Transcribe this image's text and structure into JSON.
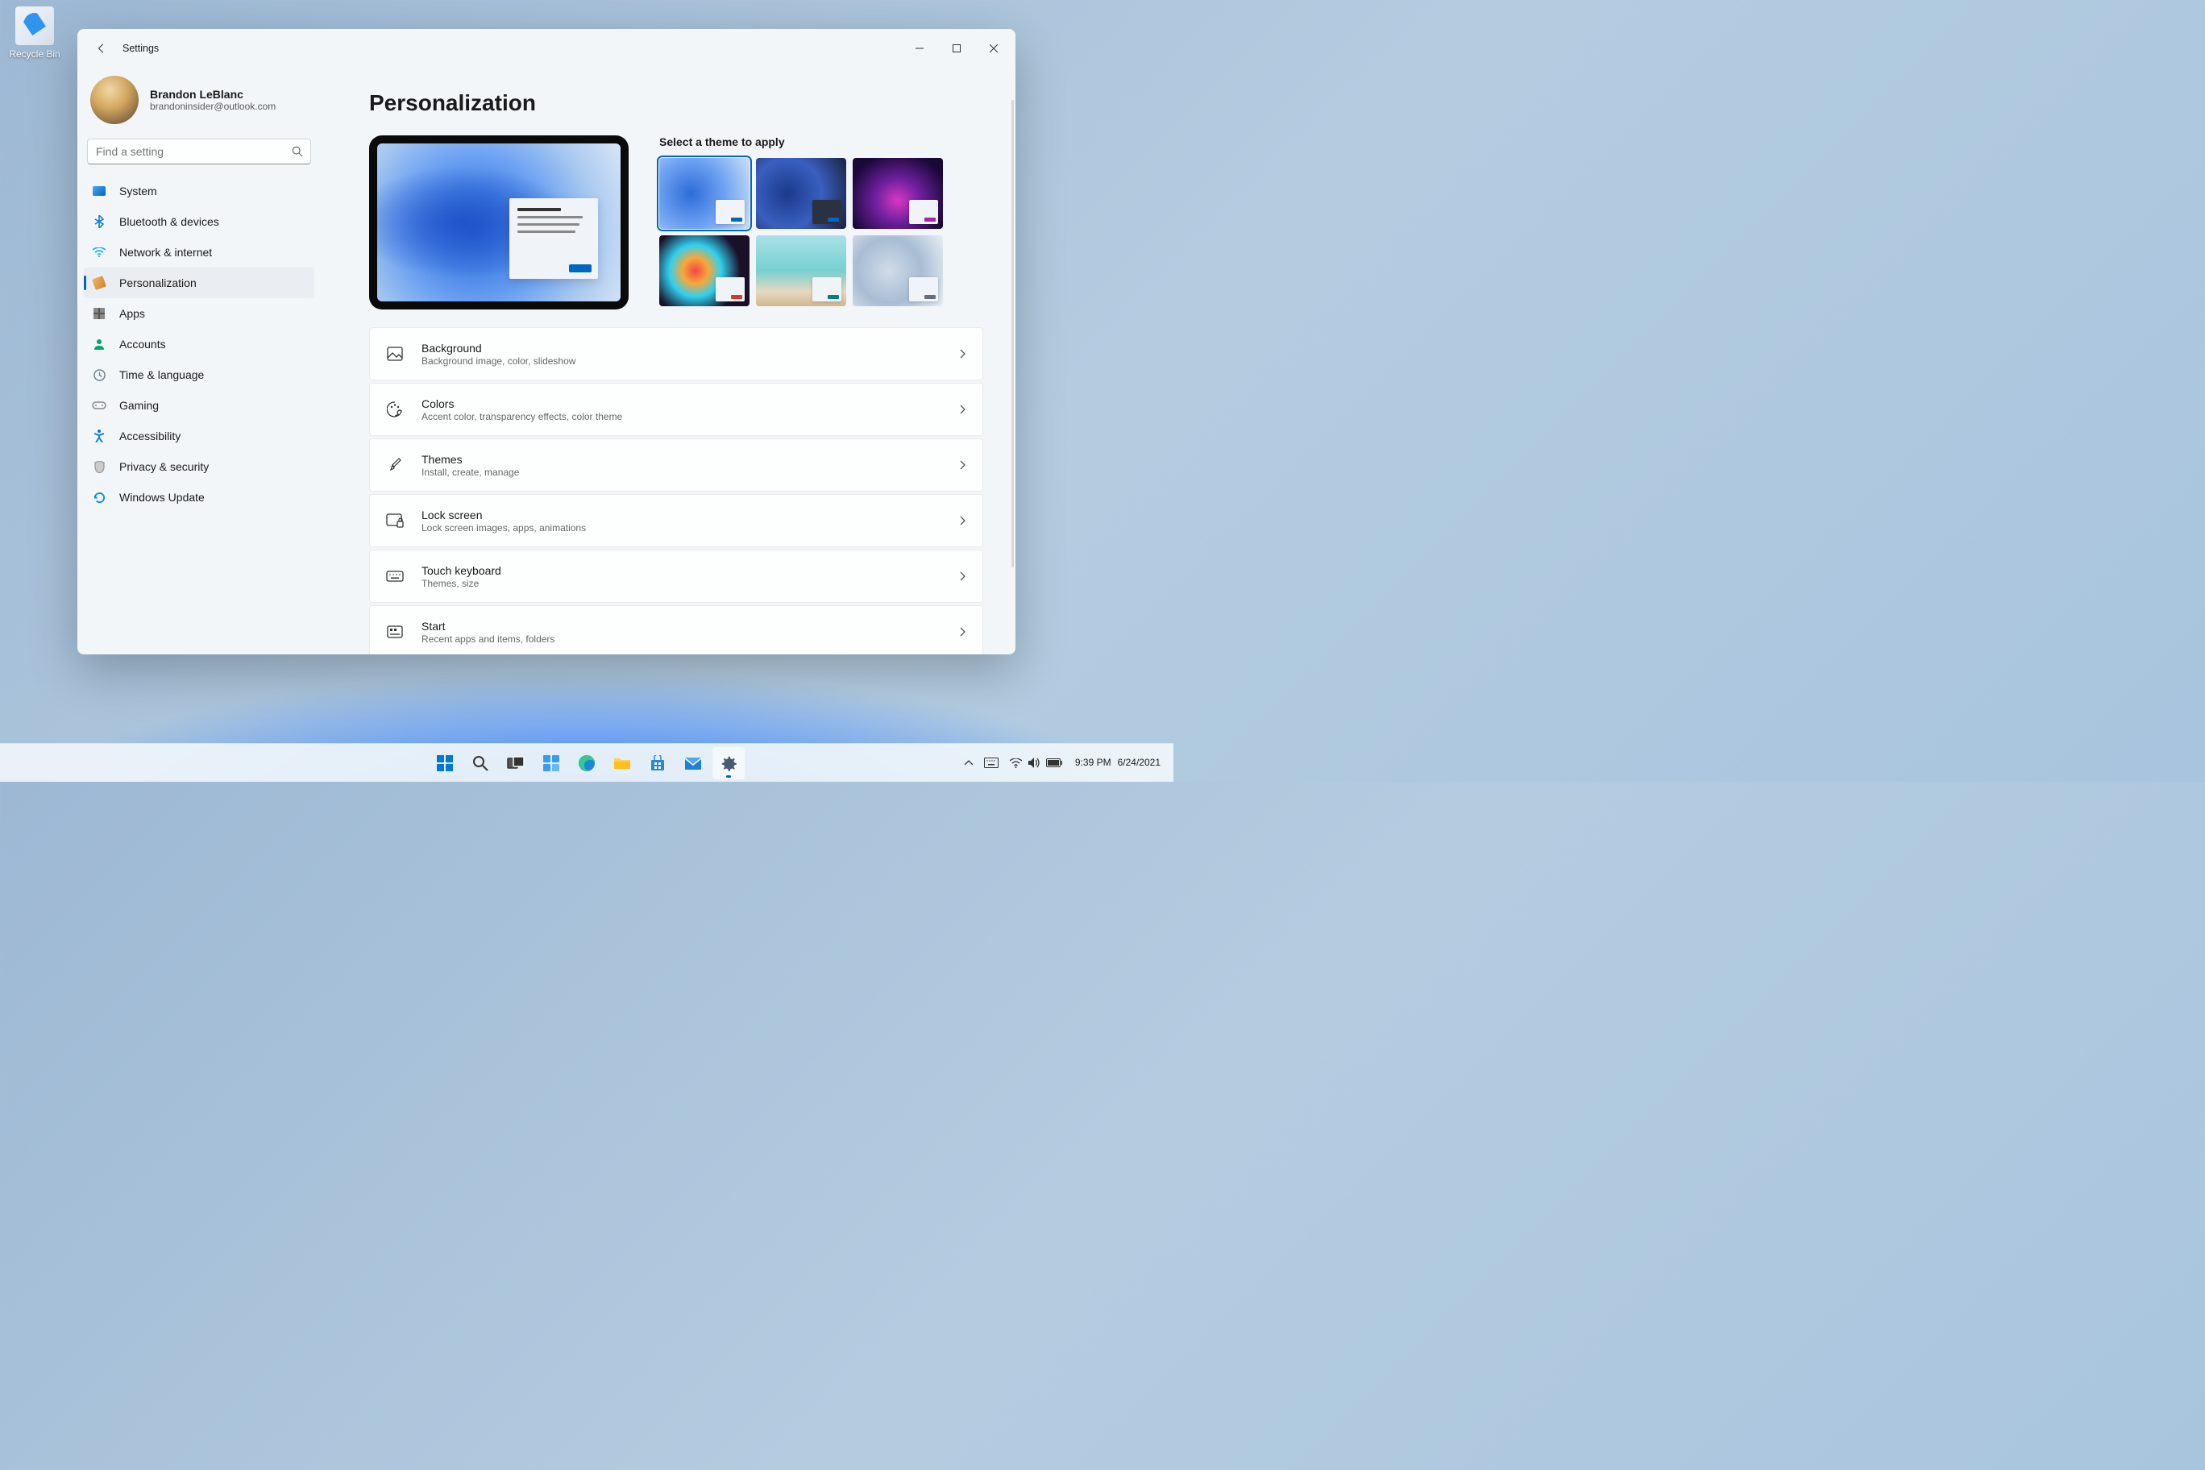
{
  "desktop": {
    "recycle_bin": "Recycle Bin"
  },
  "window": {
    "title": "Settings",
    "user": {
      "name": "Brandon LeBlanc",
      "email": "brandoninsider@outlook.com"
    },
    "search_placeholder": "Find a setting",
    "nav": [
      {
        "id": "system",
        "label": "System"
      },
      {
        "id": "bluetooth",
        "label": "Bluetooth & devices"
      },
      {
        "id": "network",
        "label": "Network & internet"
      },
      {
        "id": "personalization",
        "label": "Personalization",
        "active": true
      },
      {
        "id": "apps",
        "label": "Apps"
      },
      {
        "id": "accounts",
        "label": "Accounts"
      },
      {
        "id": "time",
        "label": "Time & language"
      },
      {
        "id": "gaming",
        "label": "Gaming"
      },
      {
        "id": "accessibility",
        "label": "Accessibility"
      },
      {
        "id": "privacy",
        "label": "Privacy & security"
      },
      {
        "id": "update",
        "label": "Windows Update"
      }
    ],
    "page": {
      "heading": "Personalization",
      "theme_label": "Select a theme to apply",
      "themes": [
        {
          "id": "windows-light",
          "accent": "#0067c0",
          "selected": true
        },
        {
          "id": "windows-dark",
          "accent": "#0067c0"
        },
        {
          "id": "glow",
          "accent": "#a028a0"
        },
        {
          "id": "captured-motion",
          "accent": "#d03838"
        },
        {
          "id": "sunrise",
          "accent": "#008080"
        },
        {
          "id": "flow",
          "accent": "#607080"
        }
      ],
      "rows": [
        {
          "id": "background",
          "title": "Background",
          "desc": "Background image, color, slideshow"
        },
        {
          "id": "colors",
          "title": "Colors",
          "desc": "Accent color, transparency effects, color theme"
        },
        {
          "id": "themes",
          "title": "Themes",
          "desc": "Install, create, manage"
        },
        {
          "id": "lockscreen",
          "title": "Lock screen",
          "desc": "Lock screen images, apps, animations"
        },
        {
          "id": "touchkeyboard",
          "title": "Touch keyboard",
          "desc": "Themes, size"
        },
        {
          "id": "start",
          "title": "Start",
          "desc": "Recent apps and items, folders"
        }
      ]
    }
  },
  "taskbar": {
    "apps": [
      {
        "id": "start",
        "name": "start-button"
      },
      {
        "id": "search",
        "name": "search-button"
      },
      {
        "id": "taskview",
        "name": "task-view-button"
      },
      {
        "id": "widgets",
        "name": "widgets-button"
      },
      {
        "id": "edge",
        "name": "edge-app"
      },
      {
        "id": "explorer",
        "name": "file-explorer-app"
      },
      {
        "id": "store",
        "name": "store-app"
      },
      {
        "id": "mail",
        "name": "mail-app"
      },
      {
        "id": "settings",
        "name": "settings-app",
        "active": true
      }
    ],
    "clock": {
      "time": "9:39 PM",
      "date": "6/24/2021"
    }
  }
}
